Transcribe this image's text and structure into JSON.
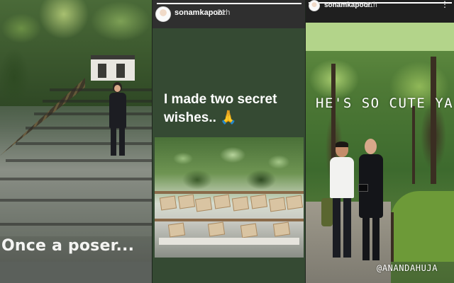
{
  "panels": [
    {
      "caption": "Once a poser..."
    },
    {
      "username": "sonamkapoor",
      "time": "21h",
      "text": "I made two secret wishes.. 🙏"
    },
    {
      "username": "sonamkapoor",
      "time": "21h",
      "menu_icon": "more-vertical-icon",
      "caption": "HE'S SO CUTE YA..",
      "tag": "@ANANDAHUJA"
    }
  ],
  "colors": {
    "story_green": "#354a33",
    "header_dark": "#2f2f2f",
    "lime_band": "#b3d48a"
  }
}
